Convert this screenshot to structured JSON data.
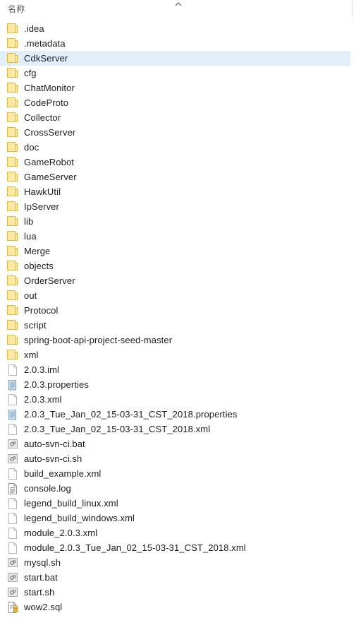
{
  "header": {
    "column_label": "名称",
    "sort_icon": "chevron-up-icon",
    "sort_direction": "ascending"
  },
  "colors": {
    "selection_background": "#e1effa",
    "folder_fill": "#fde9a6",
    "folder_border": "#e3b93c",
    "document_border": "#b4b4b4",
    "document_fill": "#ffffff",
    "properties_fill": "#cfe3f2",
    "script_fill": "#e8e8e8",
    "sql_cylinder": "#f2c14a",
    "header_text": "#5a5a5a",
    "row_text": "#1b1b20",
    "divider": "#dededa"
  },
  "files": [
    {
      "name": ".idea",
      "icon": "folder-icon",
      "type": "folder",
      "selected": false
    },
    {
      "name": ".metadata",
      "icon": "folder-icon",
      "type": "folder",
      "selected": false
    },
    {
      "name": "CdkServer",
      "icon": "folder-icon",
      "type": "folder",
      "selected": true
    },
    {
      "name": "cfg",
      "icon": "folder-icon",
      "type": "folder",
      "selected": false
    },
    {
      "name": "ChatMonitor",
      "icon": "folder-icon",
      "type": "folder",
      "selected": false
    },
    {
      "name": "CodeProto",
      "icon": "folder-icon",
      "type": "folder",
      "selected": false
    },
    {
      "name": "Collector",
      "icon": "folder-icon",
      "type": "folder",
      "selected": false
    },
    {
      "name": "CrossServer",
      "icon": "folder-icon",
      "type": "folder",
      "selected": false
    },
    {
      "name": "doc",
      "icon": "folder-icon",
      "type": "folder",
      "selected": false
    },
    {
      "name": "GameRobot",
      "icon": "folder-icon",
      "type": "folder",
      "selected": false
    },
    {
      "name": "GameServer",
      "icon": "folder-icon",
      "type": "folder",
      "selected": false
    },
    {
      "name": "HawkUtil",
      "icon": "folder-icon",
      "type": "folder",
      "selected": false
    },
    {
      "name": "IpServer",
      "icon": "folder-icon",
      "type": "folder",
      "selected": false
    },
    {
      "name": "lib",
      "icon": "folder-icon",
      "type": "folder",
      "selected": false
    },
    {
      "name": "lua",
      "icon": "folder-icon",
      "type": "folder",
      "selected": false
    },
    {
      "name": "Merge",
      "icon": "folder-icon",
      "type": "folder",
      "selected": false
    },
    {
      "name": "objects",
      "icon": "folder-icon",
      "type": "folder",
      "selected": false
    },
    {
      "name": "OrderServer",
      "icon": "folder-icon",
      "type": "folder",
      "selected": false
    },
    {
      "name": "out",
      "icon": "folder-icon",
      "type": "folder",
      "selected": false
    },
    {
      "name": "Protocol",
      "icon": "folder-icon",
      "type": "folder",
      "selected": false
    },
    {
      "name": "script",
      "icon": "folder-icon",
      "type": "folder",
      "selected": false
    },
    {
      "name": "spring-boot-api-project-seed-master",
      "icon": "folder-icon",
      "type": "folder",
      "selected": false
    },
    {
      "name": "xml",
      "icon": "folder-icon",
      "type": "folder",
      "selected": false
    },
    {
      "name": "2.0.3.iml",
      "icon": "document-icon",
      "type": "file",
      "selected": false
    },
    {
      "name": "2.0.3.properties",
      "icon": "properties-file-icon",
      "type": "file",
      "selected": false
    },
    {
      "name": "2.0.3.xml",
      "icon": "document-icon",
      "type": "file",
      "selected": false
    },
    {
      "name": "2.0.3_Tue_Jan_02_15-03-31_CST_2018.properties",
      "icon": "properties-file-icon",
      "type": "file",
      "selected": false
    },
    {
      "name": "2.0.3_Tue_Jan_02_15-03-31_CST_2018.xml",
      "icon": "document-icon",
      "type": "file",
      "selected": false
    },
    {
      "name": "auto-svn-ci.bat",
      "icon": "script-file-icon",
      "type": "file",
      "selected": false
    },
    {
      "name": "auto-svn-ci.sh",
      "icon": "script-file-icon",
      "type": "file",
      "selected": false
    },
    {
      "name": "build_example.xml",
      "icon": "document-icon",
      "type": "file",
      "selected": false
    },
    {
      "name": "console.log",
      "icon": "log-file-icon",
      "type": "file",
      "selected": false
    },
    {
      "name": "legend_build_linux.xml",
      "icon": "document-icon",
      "type": "file",
      "selected": false
    },
    {
      "name": "legend_build_windows.xml",
      "icon": "document-icon",
      "type": "file",
      "selected": false
    },
    {
      "name": "module_2.0.3.xml",
      "icon": "document-icon",
      "type": "file",
      "selected": false
    },
    {
      "name": "module_2.0.3_Tue_Jan_02_15-03-31_CST_2018.xml",
      "icon": "document-icon",
      "type": "file",
      "selected": false
    },
    {
      "name": "mysql.sh",
      "icon": "script-file-icon",
      "type": "file",
      "selected": false
    },
    {
      "name": "start.bat",
      "icon": "script-file-icon",
      "type": "file",
      "selected": false
    },
    {
      "name": "start.sh",
      "icon": "script-file-icon",
      "type": "file",
      "selected": false
    },
    {
      "name": "wow2.sql",
      "icon": "sql-file-icon",
      "type": "file",
      "selected": false
    }
  ]
}
